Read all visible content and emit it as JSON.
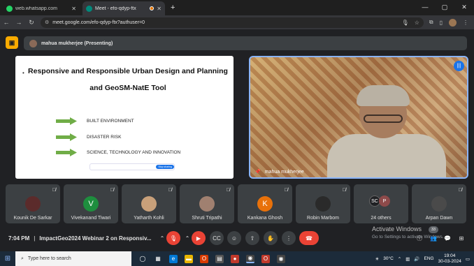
{
  "browser": {
    "tabs": [
      {
        "title": "web.whatsapp.com",
        "active": false
      },
      {
        "title": "Meet - efo-qdyp-ftx",
        "active": true
      }
    ],
    "new_tab": "+",
    "url": "meet.google.com/efo-qdyp-ftx?authuser=0"
  },
  "meet": {
    "presenter_banner": "mahua mukherjee (Presenting)",
    "slide": {
      "title_line1": "Responsive and Responsible Urban Design and Planning",
      "title_line2": "and GeoSM-NatE Tool",
      "bullets": [
        "BUILT ENVIRONMENT",
        "DISASTER RISK",
        "SCIENCE, TECHNOLOGY AND INNOVATION"
      ],
      "mini_button": "Stop sharing"
    },
    "main_video_name": "mahua mukherjee",
    "participants": [
      {
        "name": "Kounik De Sarkar",
        "initial": "",
        "color": "#5b2b2b"
      },
      {
        "name": "Vivekanand Tiwari",
        "initial": "V",
        "color": "#1e8e3e"
      },
      {
        "name": "Yatharth Kohli",
        "initial": "",
        "color": "#c8a07a"
      },
      {
        "name": "Shruti Tripathi",
        "initial": "",
        "color": "#a08070"
      },
      {
        "name": "Kankana Ghosh",
        "initial": "K",
        "color": "#e8710a"
      },
      {
        "name": "Robin Marbom",
        "initial": "",
        "color": "#2a2a2a"
      },
      {
        "name": "24 others",
        "initial": "",
        "color": "#3c4043"
      },
      {
        "name": "Arpan Dawn",
        "initial": "",
        "color": "#4a4a4a"
      }
    ],
    "others_avatars": [
      "SC",
      "P"
    ],
    "time": "7:04 PM",
    "meeting_title": "ImpactGeo2024 Webinar 2 on Responsiv...",
    "activate_windows": "Activate Windows",
    "activate_hint": "Go to Settings to activate Windows.",
    "notification_count": "33"
  },
  "taskbar": {
    "search_placeholder": "Type here to search",
    "weather": "30°C",
    "language": "ENG",
    "clock_time": "19:04",
    "clock_date": "30-03-2024"
  }
}
